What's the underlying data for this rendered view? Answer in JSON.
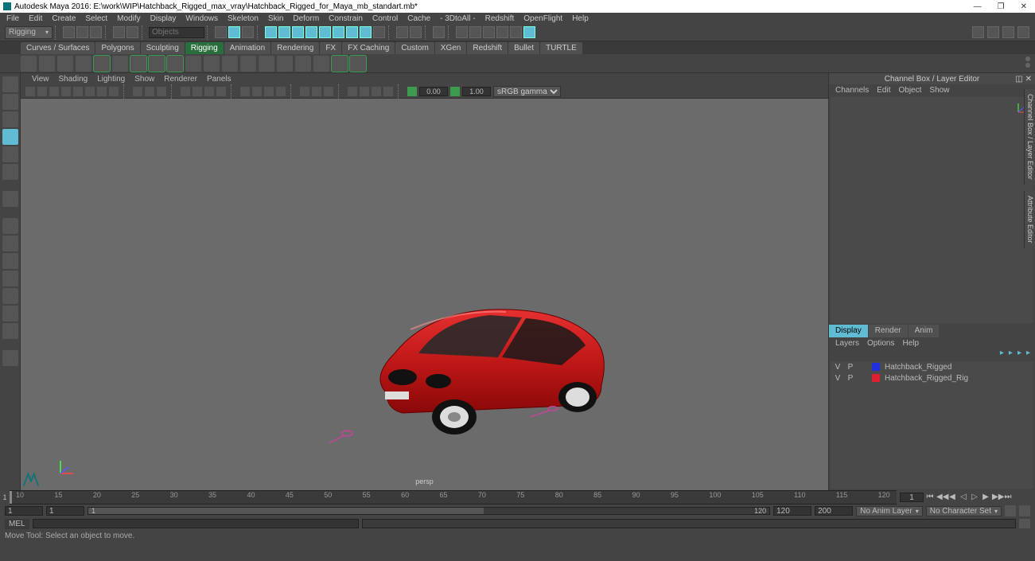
{
  "title": "Autodesk Maya 2016: E:\\work\\WIP\\Hatchback_Rigged_max_vray\\Hatchback_Rigged_for_Maya_mb_standart.mb*",
  "menu": [
    "File",
    "Edit",
    "Create",
    "Select",
    "Modify",
    "Display",
    "Windows",
    "Skeleton",
    "Skin",
    "Deform",
    "Constrain",
    "Control",
    "Cache",
    "- 3DtoAll -",
    "Redshift",
    "OpenFlight",
    "Help"
  ],
  "workspace": "Rigging",
  "search_placeholder": "Objects",
  "shelf_tabs": [
    "Curves / Surfaces",
    "Polygons",
    "Sculpting",
    "Rigging",
    "Animation",
    "Rendering",
    "FX",
    "FX Caching",
    "Custom",
    "XGen",
    "Redshift",
    "Bullet",
    "TURTLE"
  ],
  "active_tab": "Rigging",
  "vp_menu": [
    "View",
    "Shading",
    "Lighting",
    "Show",
    "Renderer",
    "Panels"
  ],
  "vp_gamma_a": "0.00",
  "vp_gamma_b": "1.00",
  "vp_color": "sRGB gamma",
  "vp_label": "persp",
  "channel_title": "Channel Box / Layer Editor",
  "channel_menu": [
    "Channels",
    "Edit",
    "Object",
    "Show"
  ],
  "side_tabs": [
    "Display",
    "Render",
    "Anim"
  ],
  "side_opt": [
    "Layers",
    "Options",
    "Help"
  ],
  "layers": [
    {
      "vis": "V",
      "play": "P",
      "color": "#2030e0",
      "name": "Hatchback_Rigged"
    },
    {
      "vis": "V",
      "play": "P",
      "color": "#e02030",
      "name": "Hatchback_Rigged_Rig"
    }
  ],
  "vtabs": [
    "Channel Box / Layer Editor",
    "Attribute Editor"
  ],
  "tl_head": "1",
  "tl_ticks": [
    "10",
    "15",
    "20",
    "25",
    "30",
    "35",
    "40",
    "45",
    "50",
    "55",
    "60",
    "65",
    "70",
    "75",
    "80",
    "85",
    "90",
    "95",
    "100",
    "105",
    "110",
    "115",
    "120"
  ],
  "tl_cur": "1",
  "range_start": "1",
  "range_play_start": "1",
  "range_slider_start": "1",
  "range_slider_end": "120",
  "range_play_end": "120",
  "range_end": "200",
  "anim_layer": "No Anim Layer",
  "char_set": "No Character Set",
  "cmd_lang": "MEL",
  "status": "Move Tool: Select an object to move."
}
